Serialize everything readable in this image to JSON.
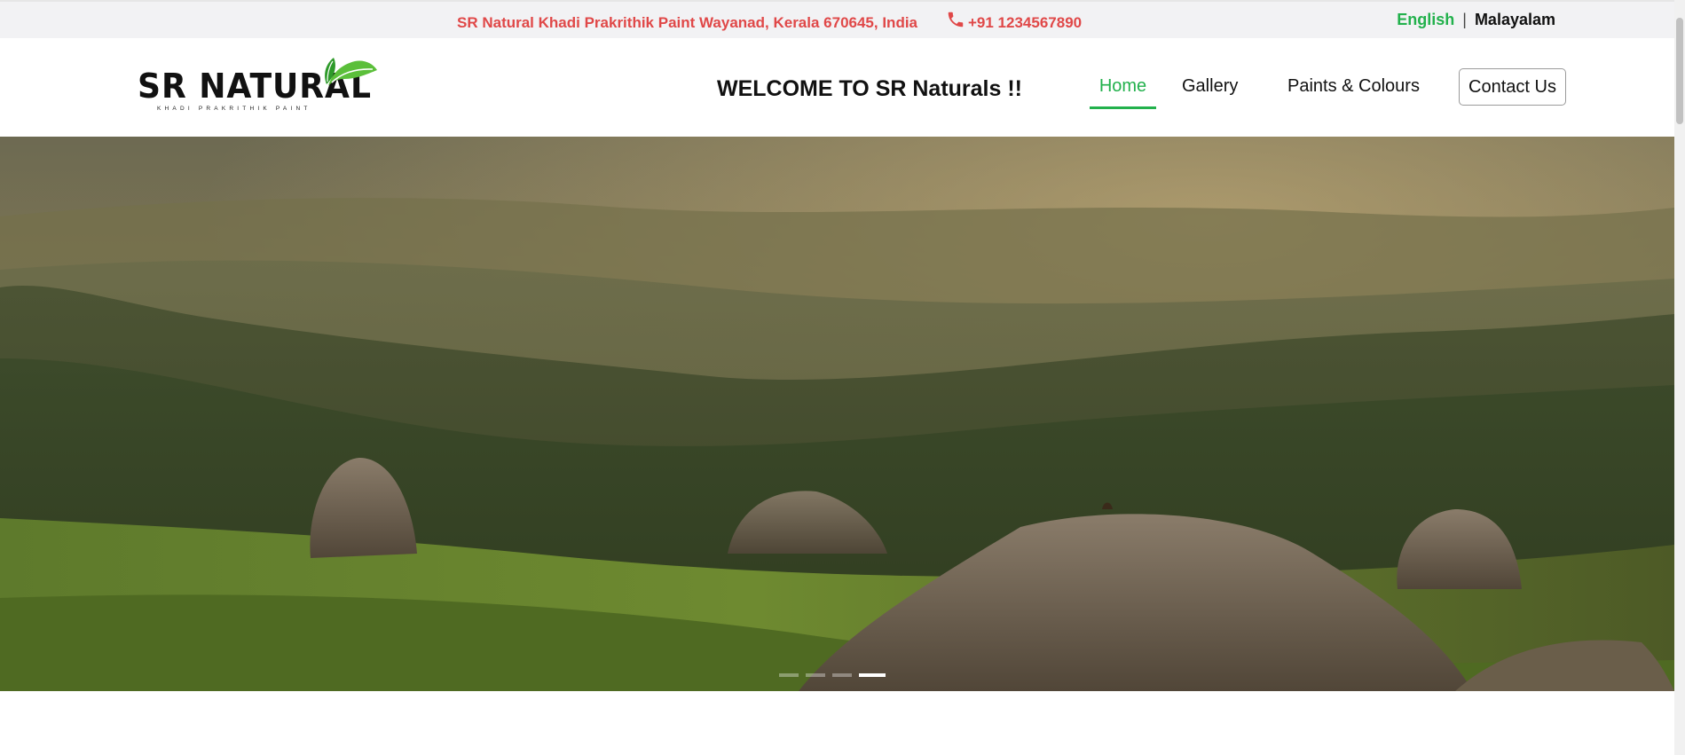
{
  "topbar": {
    "address": "SR Natural Khadi Prakrithik Paint Wayanad, Kerala 670645, India",
    "phone": "+91 1234567890",
    "phone_icon": "phone-icon",
    "languages": {
      "english": "English",
      "separator": "|",
      "malayalam": "Malayalam"
    }
  },
  "header": {
    "logo": {
      "wordmark": "SR NATURAL",
      "tagline": "KHADI PRAKRITHIK PAINT",
      "icon": "leaf-icon"
    },
    "welcome": "WELCOME TO SR Naturals !!",
    "nav": {
      "home": "Home",
      "gallery": "Gallery",
      "paints": "Paints & Colours",
      "contact": "Contact Us"
    }
  },
  "hero": {
    "slide_count": 4,
    "active_slide": 4
  },
  "colors": {
    "accent_green": "#22b14c",
    "address_red": "#e04848",
    "topbar_bg": "#f2f2f4"
  }
}
